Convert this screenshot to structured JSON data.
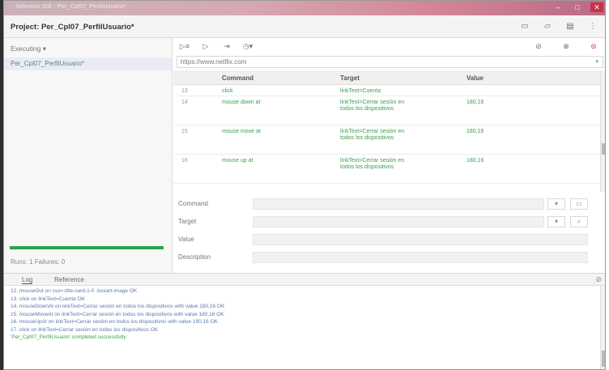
{
  "window": {
    "title": "Selenium IDE - Per_CpI07_PerfilUsuario*"
  },
  "project": {
    "label": "Project: Per_Cpl07_PerfilUsuario*"
  },
  "sidebar": {
    "status": "Executing",
    "test_item": "Per_Cpl07_PerfilUsuario*",
    "runs_text": "Runs: 1    Failures: 0",
    "progress_color": "#2aa34a"
  },
  "url": {
    "value": "https://www.netflix.com"
  },
  "table": {
    "headers": {
      "command": "Command",
      "target": "Target",
      "value": "Value"
    },
    "rows": [
      {
        "n": "13",
        "command": "click",
        "target": "linkText=Cuenta",
        "value": ""
      },
      {
        "n": "14",
        "command": "mouse down at",
        "target": "linkText=Cerrar sesión en todos los dispositivos",
        "value": "180,16"
      },
      {
        "n": "15",
        "command": "mouse move at",
        "target": "linkText=Cerrar sesión en todos los dispositivos",
        "value": "180,16"
      },
      {
        "n": "16",
        "command": "mouse up at",
        "target": "linkText=Cerrar sesión en todos los dispositivos",
        "value": "180,16"
      }
    ]
  },
  "editor": {
    "command_label": "Command",
    "target_label": "Target",
    "value_label": "Value",
    "description_label": "Description"
  },
  "log": {
    "tab_log": "Log",
    "tab_reference": "Reference",
    "lines": [
      "12. mouseOut on css=.title-card-1-0 .boxart-image OK",
      "13. click on linkText=Cuenta OK",
      "14. mouseDownAt on linkText=Cerrar sesión en todos los dispositivos with value 180,16 OK",
      "15. mouseMoveAt on linkText=Cerrar sesión en todos los dispositivos with value 180,16 OK",
      "16. mouseUpAt on linkText=Cerrar sesión en todos los dispositivos with value 180,16 OK",
      "17. click on linkText=Cerrar sesión en todos los dispositivos OK"
    ],
    "completed": "'Per_Cpl07_PerfilUsuario' completed successfully"
  }
}
